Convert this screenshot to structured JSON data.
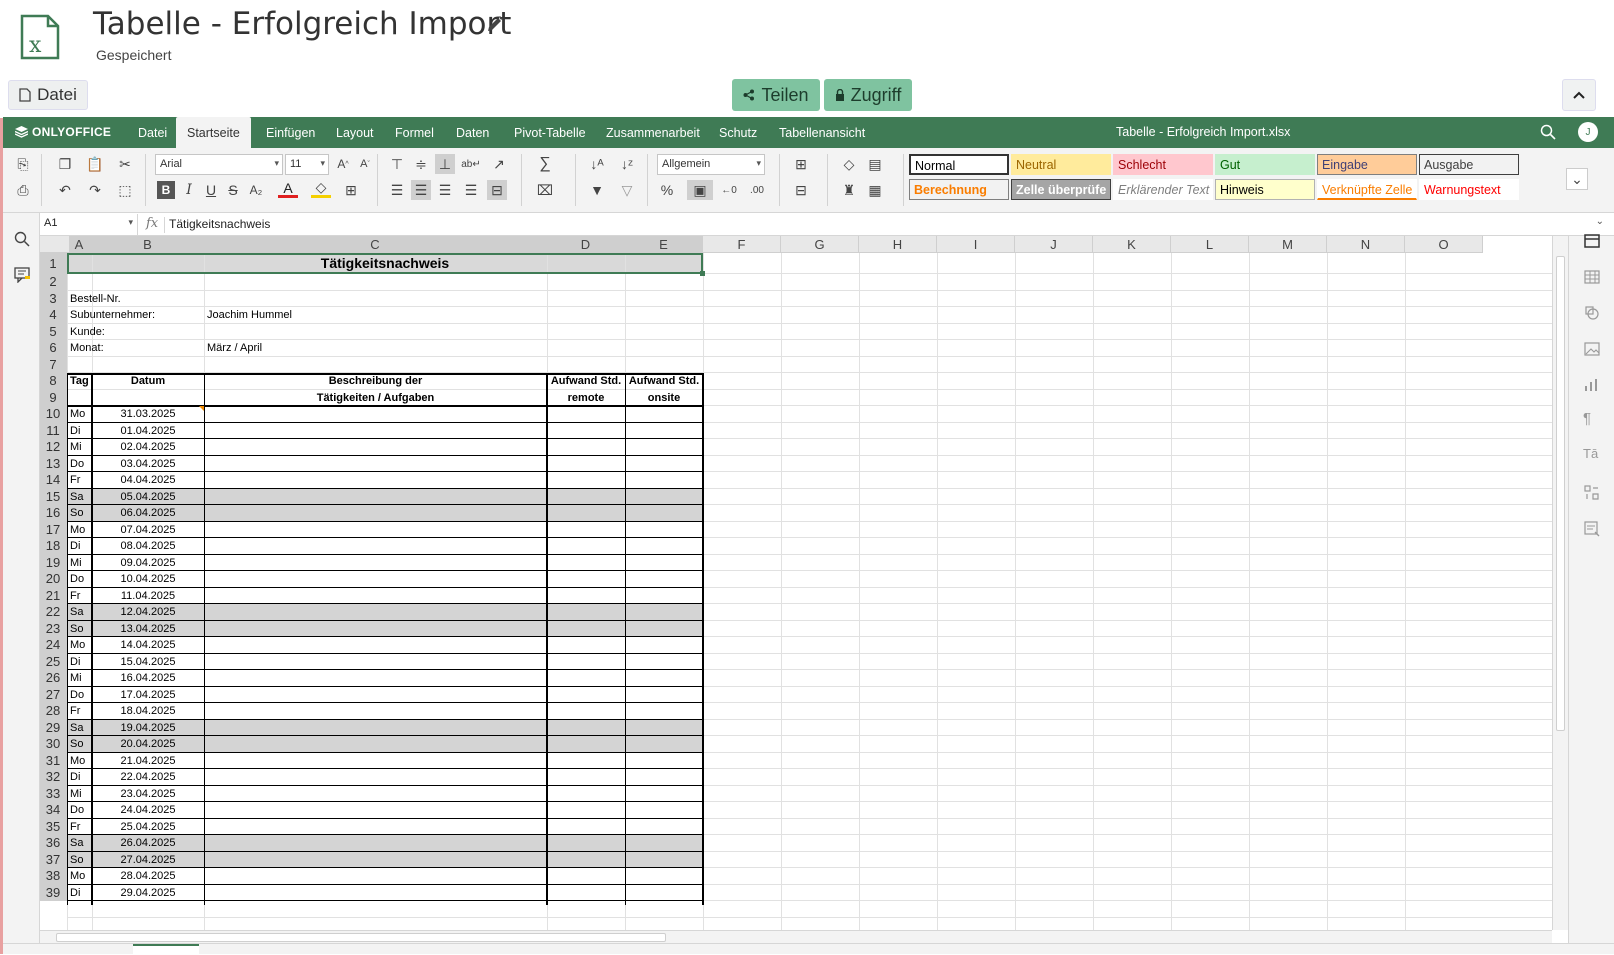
{
  "document": {
    "title": "Tabelle - Erfolgreich Import",
    "status": "Gespeichert",
    "file_button": "Datei",
    "share_button": "Teilen",
    "access_button": "Zugriff"
  },
  "menubar": {
    "logo": "ONLYOFFICE",
    "tabs": [
      "Datei",
      "Startseite",
      "Einfügen",
      "Layout",
      "Formel",
      "Daten",
      "Pivot-Tabelle",
      "Zusammenarbeit",
      "Schutz",
      "Tabellenansicht"
    ],
    "active_tab": "Startseite",
    "file_name": "Tabelle - Erfolgreich Import.xlsx",
    "user_initial": "J"
  },
  "toolbar": {
    "font_name": "Arial",
    "font_size": "11",
    "number_format": "Allgemein",
    "cell_styles": [
      {
        "label": "Normal",
        "bg": "#ffffff",
        "fg": "#000000",
        "border": "#333333"
      },
      {
        "label": "Neutral",
        "bg": "#ffeb9c",
        "fg": "#9c6500",
        "border": "#ffeb9c"
      },
      {
        "label": "Schlecht",
        "bg": "#ffc7ce",
        "fg": "#9c0006",
        "border": "#ffc7ce"
      },
      {
        "label": "Gut",
        "bg": "#c6efce",
        "fg": "#006100",
        "border": "#c6efce"
      },
      {
        "label": "Eingabe",
        "bg": "#ffcc99",
        "fg": "#3f3f76",
        "border": "#7f7f7f"
      },
      {
        "label": "Ausgabe",
        "bg": "#f2f2f2",
        "fg": "#3f3f3f",
        "border": "#3f3f3f"
      },
      {
        "label": "Berechnung",
        "bg": "#f2f2f2",
        "fg": "#fa7d00",
        "border": "#7f7f7f"
      },
      {
        "label": "Zelle überprüfe",
        "bg": "#a5a5a5",
        "fg": "#ffffff",
        "border": "#3f3f3f"
      },
      {
        "label": "Erklärender Text",
        "bg": "#ffffff",
        "fg": "#7f7f7f",
        "border": "#ffffff"
      },
      {
        "label": "Hinweis",
        "bg": "#ffffcc",
        "fg": "#000000",
        "border": "#b2b2b2"
      },
      {
        "label": "Verknüpfte Zelle",
        "bg": "#ffffff",
        "fg": "#fa7d00",
        "border": "#ffffff"
      },
      {
        "label": "Warnungstext",
        "bg": "#ffffff",
        "fg": "#ff0000",
        "border": "#ffffff"
      }
    ]
  },
  "formula_bar": {
    "cell_ref": "A1",
    "fx": "fx",
    "content": "Tätigkeitsnachweis"
  },
  "sheet": {
    "columns": [
      "A",
      "B",
      "C",
      "D",
      "E",
      "F",
      "G",
      "H",
      "I",
      "J",
      "K",
      "L",
      "M",
      "N",
      "O"
    ],
    "row_numbers": [
      "1",
      "2",
      "3",
      "4",
      "5",
      "6",
      "7",
      "8",
      "9",
      "10",
      "11",
      "12",
      "13",
      "14",
      "15",
      "16",
      "17",
      "18",
      "19",
      "20",
      "21",
      "22",
      "23",
      "24",
      "25",
      "26",
      "27",
      "28",
      "29",
      "30",
      "31",
      "32",
      "33",
      "34",
      "35",
      "36",
      "37",
      "38",
      "39"
    ],
    "title": "Tätigkeitsnachweis",
    "info": [
      {
        "label": "Bestell-Nr.",
        "value": ""
      },
      {
        "label": "Subunternehmer:",
        "value": "Joachim Hummel"
      },
      {
        "label": "Kunde:",
        "value": ""
      },
      {
        "label": "Monat:",
        "value": "März / April"
      }
    ],
    "header": {
      "tag": "Tag",
      "datum": "Datum",
      "beschreibung_1": "Beschreibung der",
      "beschreibung_2": "Tätigkeiten / Aufgaben",
      "remote_1": "Aufwand Std.",
      "remote_2": "remote",
      "onsite_1": "Aufwand Std.",
      "onsite_2": "onsite"
    },
    "days": [
      {
        "tag": "Mo",
        "datum": "31.03.2025",
        "weekend": false
      },
      {
        "tag": "Di",
        "datum": "01.04.2025",
        "weekend": false
      },
      {
        "tag": "Mi",
        "datum": "02.04.2025",
        "weekend": false
      },
      {
        "tag": "Do",
        "datum": "03.04.2025",
        "weekend": false
      },
      {
        "tag": "Fr",
        "datum": "04.04.2025",
        "weekend": false
      },
      {
        "tag": "Sa",
        "datum": "05.04.2025",
        "weekend": true
      },
      {
        "tag": "So",
        "datum": "06.04.2025",
        "weekend": true
      },
      {
        "tag": "Mo",
        "datum": "07.04.2025",
        "weekend": false
      },
      {
        "tag": "Di",
        "datum": "08.04.2025",
        "weekend": false
      },
      {
        "tag": "Mi",
        "datum": "09.04.2025",
        "weekend": false
      },
      {
        "tag": "Do",
        "datum": "10.04.2025",
        "weekend": false
      },
      {
        "tag": "Fr",
        "datum": "11.04.2025",
        "weekend": false
      },
      {
        "tag": "Sa",
        "datum": "12.04.2025",
        "weekend": true
      },
      {
        "tag": "So",
        "datum": "13.04.2025",
        "weekend": true
      },
      {
        "tag": "Mo",
        "datum": "14.04.2025",
        "weekend": false
      },
      {
        "tag": "Di",
        "datum": "15.04.2025",
        "weekend": false
      },
      {
        "tag": "Mi",
        "datum": "16.04.2025",
        "weekend": false
      },
      {
        "tag": "Do",
        "datum": "17.04.2025",
        "weekend": false
      },
      {
        "tag": "Fr",
        "datum": "18.04.2025",
        "weekend": false
      },
      {
        "tag": "Sa",
        "datum": "19.04.2025",
        "weekend": true
      },
      {
        "tag": "So",
        "datum": "20.04.2025",
        "weekend": true
      },
      {
        "tag": "Mo",
        "datum": "21.04.2025",
        "weekend": false
      },
      {
        "tag": "Di",
        "datum": "22.04.2025",
        "weekend": false
      },
      {
        "tag": "Mi",
        "datum": "23.04.2025",
        "weekend": false
      },
      {
        "tag": "Do",
        "datum": "24.04.2025",
        "weekend": false
      },
      {
        "tag": "Fr",
        "datum": "25.04.2025",
        "weekend": false
      },
      {
        "tag": "Sa",
        "datum": "26.04.2025",
        "weekend": true
      },
      {
        "tag": "So",
        "datum": "27.04.2025",
        "weekend": true
      },
      {
        "tag": "Mo",
        "datum": "28.04.2025",
        "weekend": false
      },
      {
        "tag": "Di",
        "datum": "29.04.2025",
        "weekend": false
      }
    ]
  },
  "colors": {
    "brand_green": "#3f7b55",
    "share_button": "#7fc3a0",
    "weekend_fill": "#d4d4d4"
  }
}
